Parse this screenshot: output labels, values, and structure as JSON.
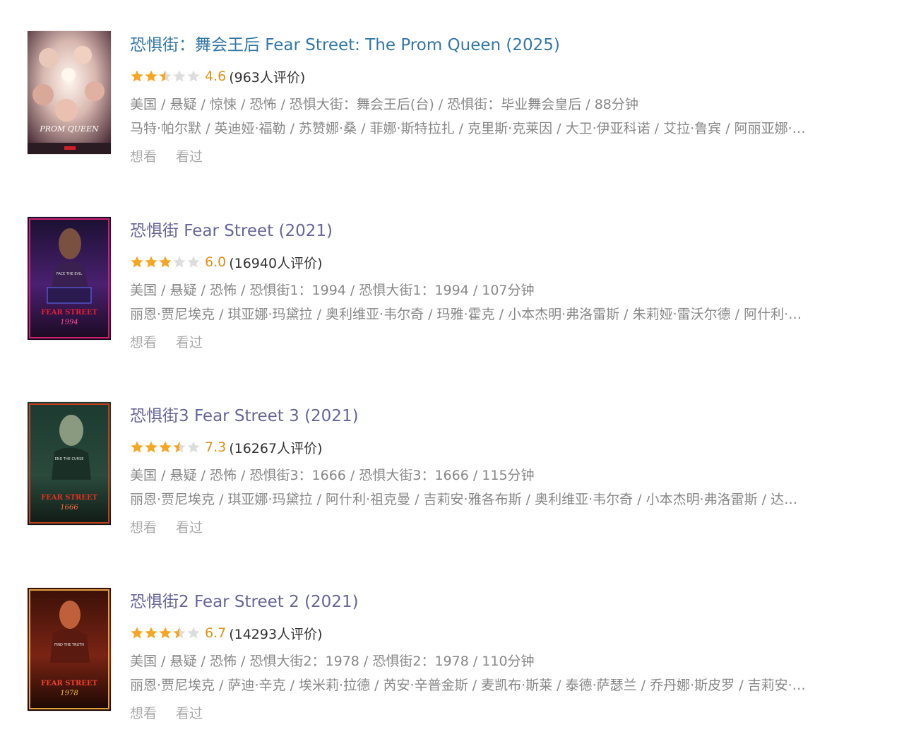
{
  "movies": [
    {
      "title": "恐惧街：舞会王后 Fear Street: The Prom Queen (2025)",
      "rating_stars": 2.5,
      "rating_score": "4.6",
      "rating_count": "(963人评价)",
      "meta": "美国 / 悬疑 / 惊悚 / 恐怖 / 恐惧大街：舞会王后(台) / 恐惧街：毕业舞会皇后 / 88分钟",
      "cast": "马特·帕尔默 / 英迪娅·福勒 / 苏赞娜·桑 / 菲娜·斯特拉扎 / 克里斯·克莱因 / 大卫·伊亚科诺 / 艾拉·鲁宾 / 阿丽亚娜·…",
      "want": "想看",
      "watched": "看过",
      "poster_icon": "prom-queen-poster",
      "poster_text": "PROM QUEEN",
      "poster_colors": [
        "#d8c4c0",
        "#b98e88",
        "#5a3c44"
      ]
    },
    {
      "title": "恐惧街 Fear Street (2021)",
      "rating_stars": 3,
      "rating_score": "6.0",
      "rating_count": "(16940人评价)",
      "meta": "美国 / 悬疑 / 恐怖 / 恐惧街1：1994 / 恐惧大街1：1994 / 107分钟",
      "cast": "丽恩·贾尼埃克 / 琪亚娜·玛黛拉 / 奥利维亚·韦尔奇 / 玛雅·霍克 / 小本杰明·弗洛雷斯 / 朱莉娅·雷沃尔德 / 阿什利·…",
      "want": "想看",
      "watched": "看过",
      "poster_icon": "fear-street-1994-poster",
      "poster_text": "FEAR STREET 1994",
      "poster_colors": [
        "#2a1a4a",
        "#6a2a8a",
        "#c03030"
      ]
    },
    {
      "title": "恐惧街3 Fear Street 3 (2021)",
      "rating_stars": 3.5,
      "rating_score": "7.3",
      "rating_count": "(16267人评价)",
      "meta": "美国 / 悬疑 / 恐怖 / 恐惧街3：1666 / 恐惧大街3：1666 / 115分钟",
      "cast": "丽恩·贾尼埃克 / 琪亚娜·玛黛拉 / 阿什利·祖克曼 / 吉莉安·雅各布斯 / 奥利维亚·韦尔奇 / 小本杰明·弗洛雷斯 / 达…",
      "want": "想看",
      "watched": "看过",
      "poster_icon": "fear-street-1666-poster",
      "poster_text": "FEAR STREET 1666",
      "poster_colors": [
        "#1a3a30",
        "#2f5a48",
        "#b03020"
      ]
    },
    {
      "title": "恐惧街2 Fear Street 2 (2021)",
      "rating_stars": 3.5,
      "rating_score": "6.7",
      "rating_count": "(14293人评价)",
      "meta": "美国 / 悬疑 / 恐怖 / 恐惧大街2：1978 / 恐惧街2：1978 / 110分钟",
      "cast": "丽恩·贾尼埃克 / 萨迪·辛克 / 埃米莉·拉德 / 芮安·辛普金斯 / 麦凯布·斯莱 / 泰德·萨瑟兰 / 乔丹娜·斯皮罗 / 吉莉安·…",
      "want": "想看",
      "watched": "看过",
      "poster_icon": "fear-street-1978-poster",
      "poster_text": "FEAR STREET 1978",
      "poster_colors": [
        "#3a1410",
        "#8a2a18",
        "#e0a040"
      ]
    }
  ]
}
